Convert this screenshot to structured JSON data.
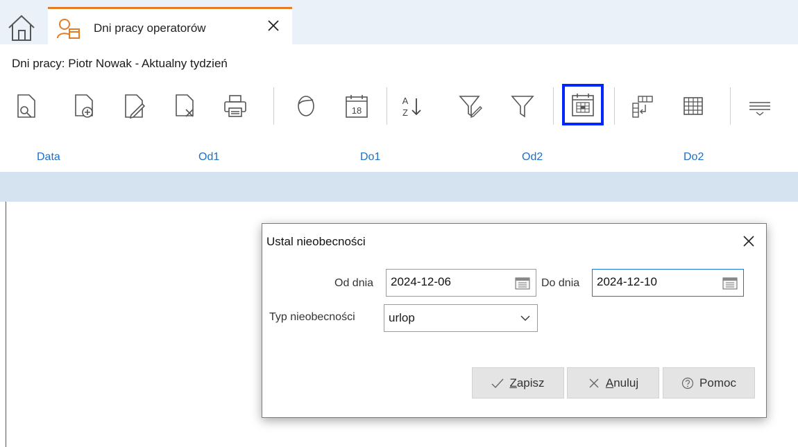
{
  "tabs": {
    "document_tab_title": "Dni pracy operatorów"
  },
  "window": {
    "title": "Dni pracy: Piotr Nowak - Aktualny tydzień"
  },
  "toolbar": {
    "calendar_day": "18"
  },
  "columns": [
    "Data",
    "Od1",
    "Do1",
    "Od2",
    "Do2"
  ],
  "dialog": {
    "title": "Ustal nieobecności",
    "from_label": "Od dnia",
    "from_value": "2024-12-06",
    "to_label": "Do dnia",
    "to_value": "2024-12-10",
    "type_label": "Typ nieobecności",
    "type_value": "urlop",
    "save_label": "apisz",
    "save_mnemonic": "Z",
    "cancel_label": "nuluj",
    "cancel_mnemonic": "A",
    "help_label": "Pomoc"
  },
  "colors": {
    "accent_tab": "#e57b22",
    "highlight_border": "#0026ff",
    "column_header": "#1d6fc7",
    "grid_row": "#d5e3f1"
  }
}
